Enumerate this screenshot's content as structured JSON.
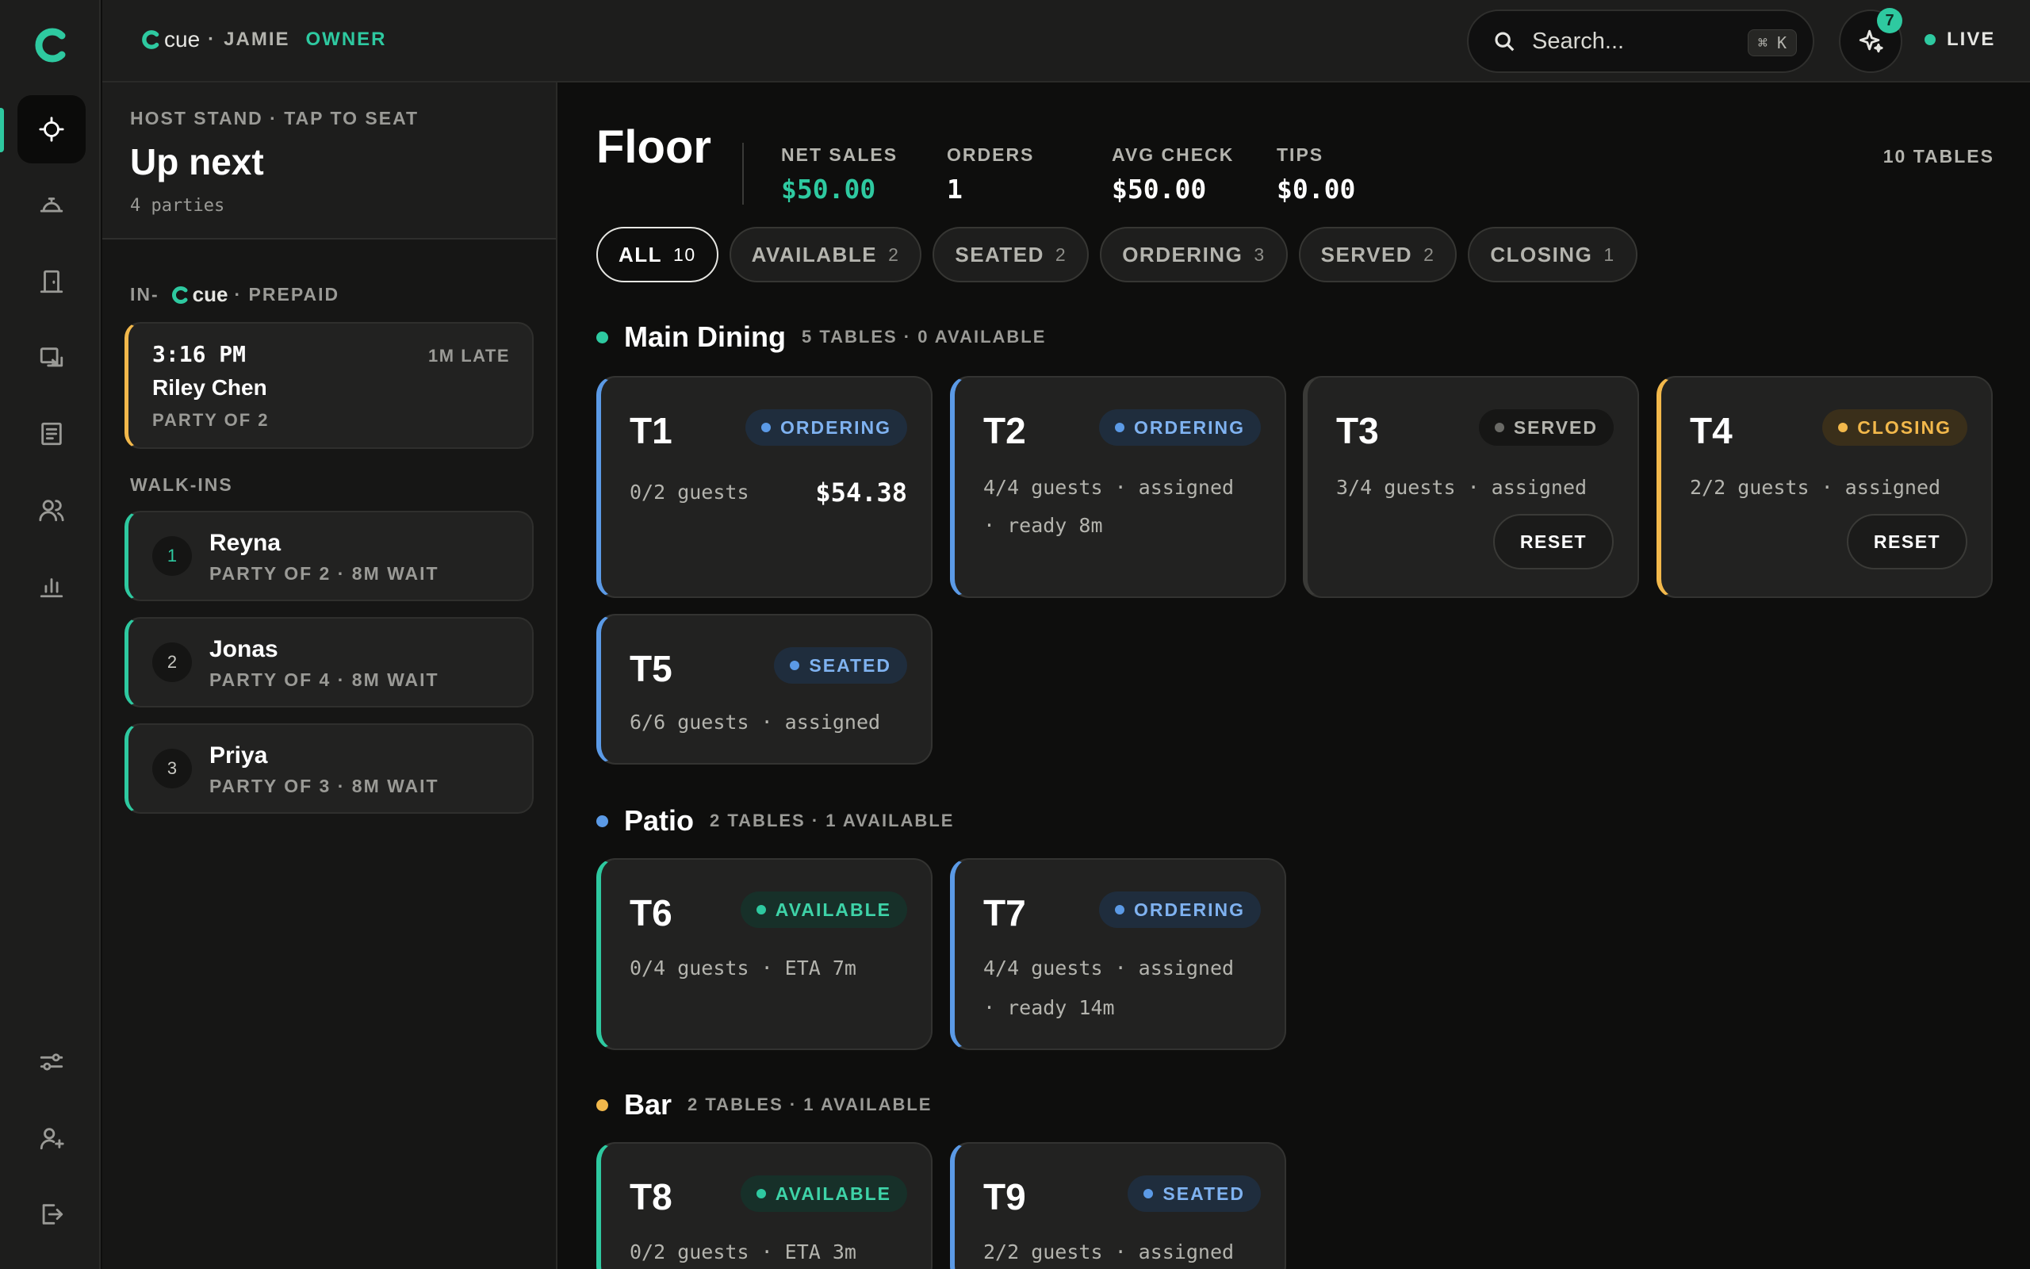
{
  "colors": {
    "accent": "#2ec9a0",
    "ordering": "#5b9ae6",
    "closing": "#f2b84b",
    "served": "#6a6a66",
    "background": "#0e0e0d"
  },
  "rail": {
    "logo": "cue-logo-icon",
    "items": [
      {
        "icon": "crosshair-icon",
        "active": true
      },
      {
        "icon": "cloche-icon"
      },
      {
        "icon": "door-icon"
      },
      {
        "icon": "screen-share-icon"
      },
      {
        "icon": "receipt-icon"
      },
      {
        "icon": "users-icon"
      },
      {
        "icon": "bar-chart-icon"
      }
    ],
    "bottom_items": [
      {
        "icon": "sliders-icon"
      },
      {
        "icon": "user-settings-icon"
      },
      {
        "icon": "logout-icon"
      }
    ]
  },
  "topbar": {
    "brand": "cue",
    "separator": "·",
    "user": "JAMIE",
    "role": "OWNER",
    "search_placeholder": "Search...",
    "search_shortcut": "⌘ K",
    "ai_badge_count": "7",
    "status": "LIVE"
  },
  "host": {
    "eyebrow": "HOST STAND · TAP TO SEAT",
    "title": "Up next",
    "subtitle": "4 parties",
    "prepaid_label_prefix": "IN-",
    "prepaid_brand": "cue",
    "prepaid_label_suffix": "· PREPAID",
    "reservation": {
      "time": "3:16 PM",
      "late": "1M LATE",
      "name": "Riley Chen",
      "party": "PARTY OF 2"
    },
    "walkins_label": "WALK-INS",
    "walkins": [
      {
        "num": "1",
        "name": "Reyna",
        "meta": "PARTY OF 2 · 8M WAIT"
      },
      {
        "num": "2",
        "name": "Jonas",
        "meta": "PARTY OF 4 · 8M WAIT"
      },
      {
        "num": "3",
        "name": "Priya",
        "meta": "PARTY OF 3 · 8M WAIT"
      }
    ]
  },
  "floor": {
    "title": "Floor",
    "stats": [
      {
        "label": "NET SALES",
        "value": "$50.00"
      },
      {
        "label": "ORDERS",
        "value": "1"
      },
      {
        "label": "AVG CHECK",
        "value": "$50.00"
      },
      {
        "label": "TIPS",
        "value": "$0.00"
      }
    ],
    "table_count": "10 TABLES",
    "filters": [
      {
        "label": "ALL",
        "count": "10"
      },
      {
        "label": "AVAILABLE",
        "count": "2"
      },
      {
        "label": "SEATED",
        "count": "2"
      },
      {
        "label": "ORDERING",
        "count": "3"
      },
      {
        "label": "SERVED",
        "count": "2"
      },
      {
        "label": "CLOSING",
        "count": "1"
      }
    ],
    "zones": [
      {
        "name": "Main Dining",
        "meta": "5 TABLES · 0 AVAILABLE"
      },
      {
        "name": "Patio",
        "meta": "2 TABLES · 1 AVAILABLE"
      },
      {
        "name": "Bar",
        "meta": "2 TABLES · 1 AVAILABLE"
      }
    ],
    "tables": {
      "t1": {
        "id": "T1",
        "status": "ORDERING",
        "line1": "0/2 guests",
        "amount": "$54.38"
      },
      "t2": {
        "id": "T2",
        "status": "ORDERING",
        "line1": "4/4 guests · assigned",
        "line2": "· ready 8m"
      },
      "t3": {
        "id": "T3",
        "status": "SERVED",
        "line1": "3/4 guests · assigned",
        "action": "RESET"
      },
      "t4": {
        "id": "T4",
        "status": "CLOSING",
        "line1": "2/2 guests · assigned",
        "action": "RESET"
      },
      "t5": {
        "id": "T5",
        "status": "SEATED",
        "line1": "6/6 guests · assigned"
      },
      "t6": {
        "id": "T6",
        "status": "AVAILABLE",
        "line1": "0/4 guests · ETA 7m"
      },
      "t7": {
        "id": "T7",
        "status": "ORDERING",
        "line1": "4/4 guests · assigned",
        "line2": "· ready 14m"
      },
      "t8": {
        "id": "T8",
        "status": "AVAILABLE",
        "line1": "0/2 guests · ETA 3m"
      },
      "t9": {
        "id": "T9",
        "status": "SEATED",
        "line1": "2/2 guests · assigned"
      }
    }
  }
}
